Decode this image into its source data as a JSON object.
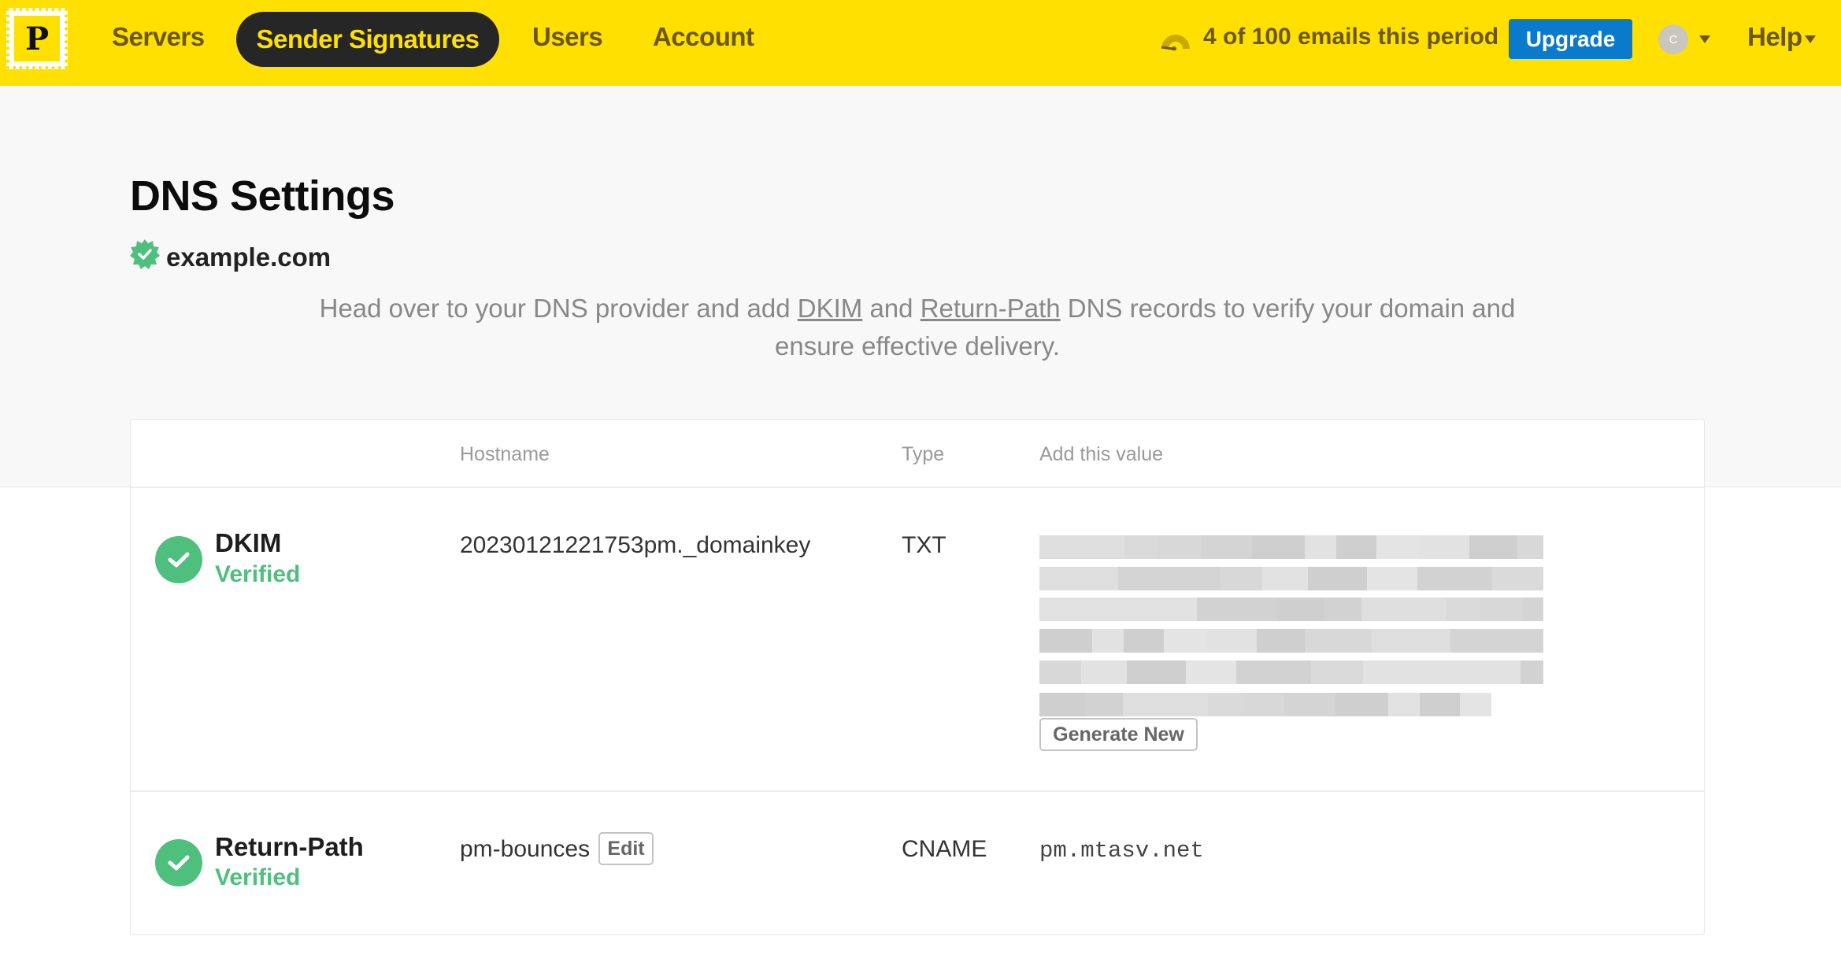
{
  "nav": {
    "logo_letter": "P",
    "items": [
      {
        "label": "Servers",
        "active": false
      },
      {
        "label": "Sender Signatures",
        "active": true
      },
      {
        "label": "Users",
        "active": false
      },
      {
        "label": "Account",
        "active": false
      }
    ],
    "usage_text": "4 of 100 emails this period",
    "usage_used": 4,
    "usage_limit": 100,
    "upgrade_label": "Upgrade",
    "avatar_initial": "C",
    "help_label": "Help",
    "colors": {
      "bar": "#FFE000",
      "active_pill": "#262626",
      "upgrade": "#0A7ACB"
    }
  },
  "page": {
    "title": "DNS Settings",
    "domain": "example.com",
    "intro_1": "Head over to your DNS provider and add ",
    "intro_link_1": "DKIM",
    "intro_2": " and ",
    "intro_link_2": "Return-Path",
    "intro_3": " DNS records to verify your domain and ensure effective delivery."
  },
  "table": {
    "headers": {
      "hostname": "Hostname",
      "type": "Type",
      "value": "Add this value"
    },
    "rows": [
      {
        "name": "DKIM",
        "status": "Verified",
        "hostname": "20230121221753pm._domainkey",
        "type": "TXT",
        "value_redacted": true,
        "action_label": "Generate New"
      },
      {
        "name": "Return-Path",
        "status": "Verified",
        "hostname": "pm-bounces",
        "edit_label": "Edit",
        "type": "CNAME",
        "value": "pm.mtasv.net"
      }
    ],
    "status_color": "#4FBF7E"
  }
}
